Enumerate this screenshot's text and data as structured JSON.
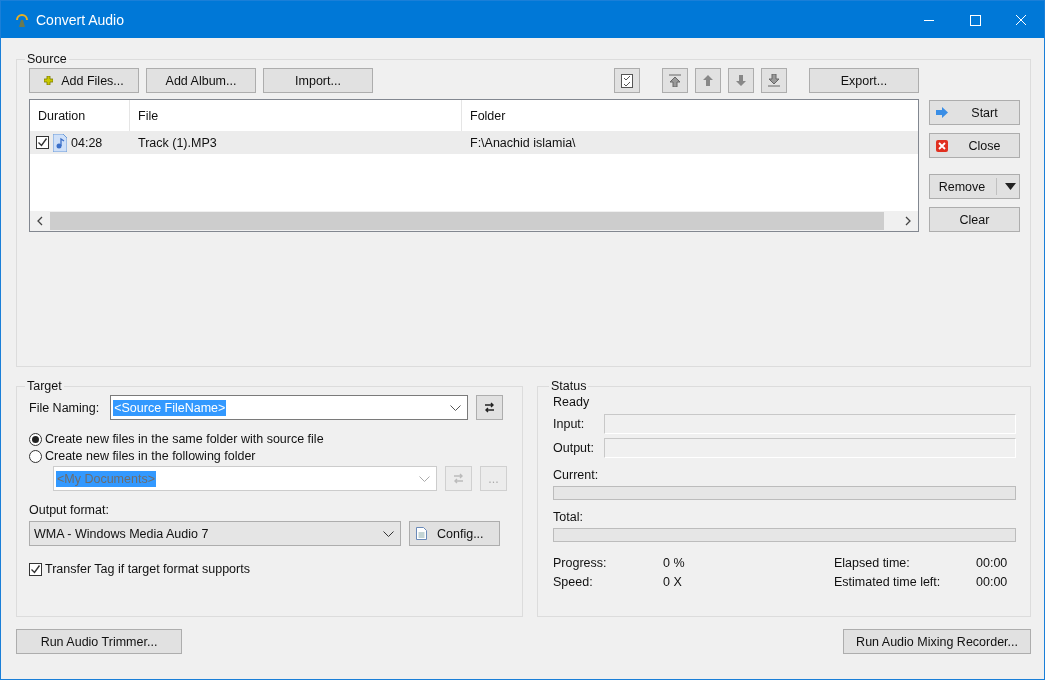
{
  "window": {
    "title": "Convert Audio"
  },
  "source": {
    "label": "Source",
    "toolbar_buttons": [
      {
        "kind": "add",
        "label": "Add Files..."
      },
      {
        "kind": "plain",
        "label": "Add Album..."
      },
      {
        "kind": "plain",
        "label": "Import..."
      }
    ],
    "export_button": "Export...",
    "columns": [
      "Duration",
      "File",
      "Folder"
    ],
    "rows": [
      {
        "checked": true,
        "selected": true,
        "duration": "04:28",
        "file": "Track (1).MP3",
        "folder": "F:\\Anachid islamia\\"
      }
    ],
    "side_buttons": [
      {
        "kind": "start",
        "label": "Start"
      },
      {
        "kind": "close",
        "label": "Close"
      },
      {
        "kind": "remove",
        "label": "Remove"
      },
      {
        "kind": "clear",
        "label": "Clear"
      }
    ]
  },
  "target": {
    "label": "Target",
    "file_naming_label": "File Naming:",
    "file_naming_value": "<Source FileName>",
    "radios": [
      {
        "label": "Create new files in the same folder with source file",
        "selected": true
      },
      {
        "label": "Create new files in the following folder",
        "selected": false
      }
    ],
    "folder": {
      "value": "<My Documents>",
      "disabled": true,
      "browse_label": "..."
    },
    "output_format_label": "Output format:",
    "output_format_value": "WMA - Windows Media Audio 7",
    "config_button": "Config...",
    "transfer_tag": {
      "label": "Transfer Tag if target format supports",
      "checked": true
    }
  },
  "status": {
    "label": "Status",
    "state": "Ready",
    "input_label": "Input:",
    "output_label": "Output:",
    "current": {
      "label": "Current:",
      "level": 0
    },
    "total": {
      "label": "Total:",
      "level": 0
    },
    "stats": [
      {
        "label": "Progress:",
        "value": "0 %"
      },
      {
        "label": "Elapsed time:",
        "value": "00:00"
      },
      {
        "label": "Speed:",
        "value": "0 X"
      },
      {
        "label": "Estimated time left:",
        "value": "00:00"
      }
    ]
  },
  "bottom_buttons": [
    "Run Audio Trimmer...",
    "Run Audio Mixing Recorder..."
  ]
}
